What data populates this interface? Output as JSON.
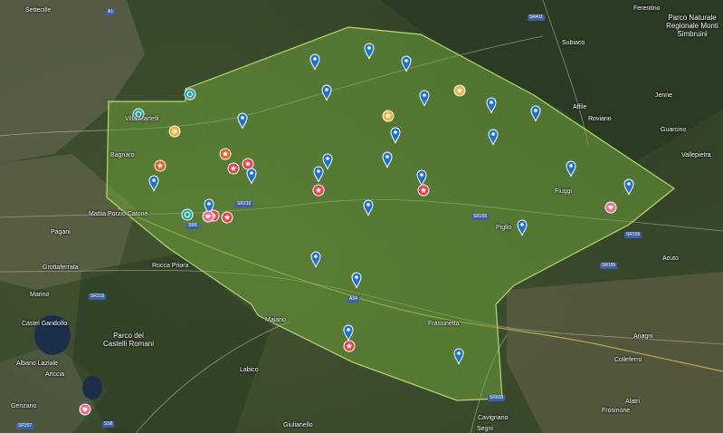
{
  "map": {
    "colors": {
      "area_fill": "#6fa83c",
      "area_stroke": "#b8d86a",
      "pin_blue": "#1e73d2",
      "pin_red": "#e8414b",
      "pin_orange": "#e0641e",
      "pin_yellow": "#f2b53a",
      "pin_teal": "#1aa59a",
      "pin_pink": "#ee6e8e",
      "shield": "#3d5fa8"
    },
    "place_labels": [
      {
        "text": "Settecille"
      },
      {
        "text": "Villa Martelli"
      },
      {
        "text": "Bagnaro"
      },
      {
        "text": "Mattia Porzio Catone"
      },
      {
        "text": "Pagani"
      },
      {
        "text": "Grottaferrata"
      },
      {
        "text": "Marino"
      },
      {
        "text": "Castel Gandolfo"
      },
      {
        "text": "Albano Laziale"
      },
      {
        "text": "Ariccia"
      },
      {
        "text": "Genzano"
      },
      {
        "text": "Rocca Priora"
      },
      {
        "text": "Maiano"
      },
      {
        "text": "Labico"
      },
      {
        "text": "Giulianello"
      },
      {
        "text": "Frassinetta"
      },
      {
        "text": "Cavignano"
      },
      {
        "text": "Segni"
      },
      {
        "text": "Anagni"
      },
      {
        "text": "Colleferro"
      },
      {
        "text": "Subiaco"
      },
      {
        "text": "Affile"
      },
      {
        "text": "Roviano"
      },
      {
        "text": "Jenne"
      },
      {
        "text": "Vallepietra"
      },
      {
        "text": "Acuto"
      },
      {
        "text": "Piglio"
      },
      {
        "text": "Fiuggi"
      },
      {
        "text": "Alatri"
      },
      {
        "text": "Frosinone"
      },
      {
        "text": "Ferentino"
      },
      {
        "text": "Guarcino"
      }
    ],
    "park_labels": [
      {
        "text": "Parco dei Castelli Romani"
      },
      {
        "text": "Parco Naturale Regionale Monti Simbruini"
      }
    ],
    "road_shields": [
      {
        "text": "A1"
      },
      {
        "text": "A24"
      },
      {
        "text": "SR155"
      },
      {
        "text": "SR6"
      },
      {
        "text": "SR215"
      },
      {
        "text": "SR411"
      },
      {
        "text": "SR609"
      },
      {
        "text": "SS6"
      },
      {
        "text": "SR207"
      },
      {
        "text": "SR155"
      },
      {
        "text": "SR155"
      },
      {
        "text": "SR216"
      }
    ],
    "markers": [
      {
        "kind": "pin",
        "color": "blue"
      },
      {
        "kind": "pin",
        "color": "blue"
      },
      {
        "kind": "pin",
        "color": "blue"
      },
      {
        "kind": "pin",
        "color": "blue"
      },
      {
        "kind": "pin",
        "color": "blue"
      },
      {
        "kind": "pin",
        "color": "blue"
      },
      {
        "kind": "pin",
        "color": "blue"
      },
      {
        "kind": "pin",
        "color": "blue"
      },
      {
        "kind": "pin",
        "color": "blue"
      },
      {
        "kind": "pin",
        "color": "blue"
      },
      {
        "kind": "pin",
        "color": "blue"
      },
      {
        "kind": "pin",
        "color": "blue"
      },
      {
        "kind": "pin",
        "color": "blue"
      },
      {
        "kind": "pin",
        "color": "blue"
      },
      {
        "kind": "pin",
        "color": "blue"
      },
      {
        "kind": "pin",
        "color": "blue"
      },
      {
        "kind": "pin",
        "color": "blue"
      },
      {
        "kind": "pin",
        "color": "blue"
      },
      {
        "kind": "pin",
        "color": "blue"
      },
      {
        "kind": "pin",
        "color": "blue"
      },
      {
        "kind": "pin",
        "color": "blue"
      },
      {
        "kind": "pin",
        "color": "blue"
      },
      {
        "kind": "pin",
        "color": "blue"
      },
      {
        "kind": "pin",
        "color": "blue"
      },
      {
        "kind": "pin",
        "color": "blue"
      },
      {
        "kind": "star",
        "color": "red"
      },
      {
        "kind": "star",
        "color": "red"
      },
      {
        "kind": "star",
        "color": "red"
      },
      {
        "kind": "star",
        "color": "red"
      },
      {
        "kind": "star",
        "color": "red"
      },
      {
        "kind": "star",
        "color": "red"
      },
      {
        "kind": "star",
        "color": "red"
      },
      {
        "kind": "star",
        "color": "orange"
      },
      {
        "kind": "star",
        "color": "orange"
      },
      {
        "kind": "star",
        "color": "yellow"
      },
      {
        "kind": "star",
        "color": "yellow"
      },
      {
        "kind": "star",
        "color": "yellow"
      },
      {
        "kind": "circle",
        "color": "teal"
      },
      {
        "kind": "circle",
        "color": "teal"
      },
      {
        "kind": "circle",
        "color": "teal"
      },
      {
        "kind": "heart",
        "color": "pink"
      },
      {
        "kind": "heart",
        "color": "pink"
      },
      {
        "kind": "heart",
        "color": "pink"
      }
    ]
  }
}
